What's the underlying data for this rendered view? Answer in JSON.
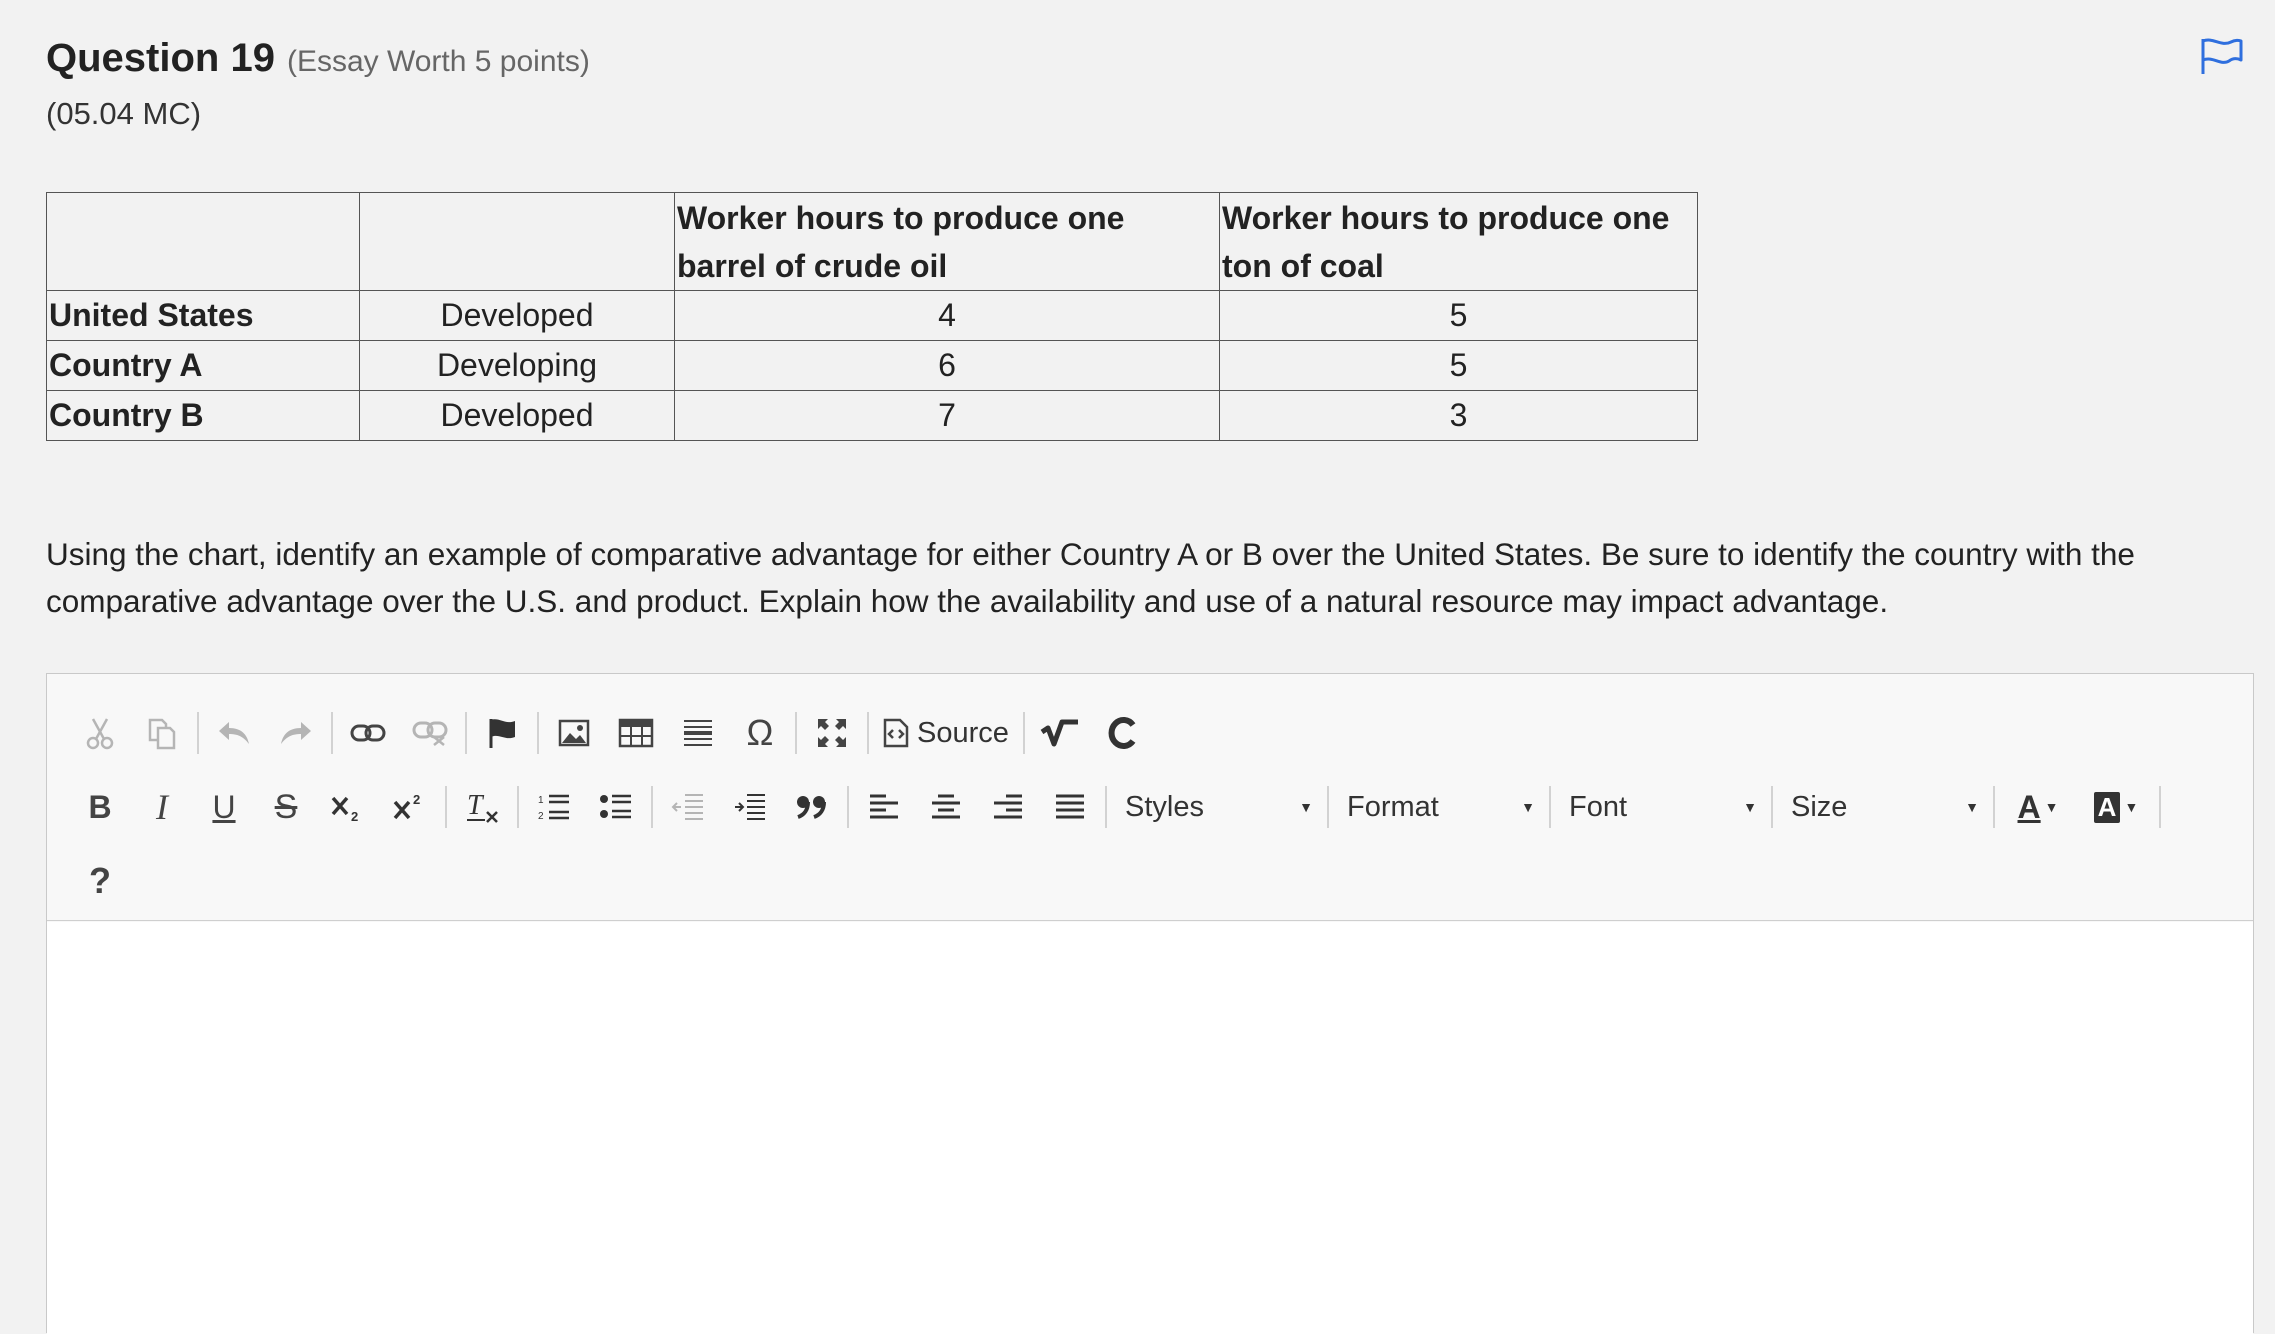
{
  "question": {
    "title": "Question 19",
    "points": "(Essay Worth 5 points)",
    "code": "(05.04 MC)"
  },
  "table": {
    "headers": [
      "",
      "",
      "Worker hours to produce one barrel of crude oil",
      "Worker hours to produce one ton of coal"
    ],
    "rows": [
      {
        "country": "United States",
        "status": "Developed",
        "oil": "4",
        "coal": "5"
      },
      {
        "country": "Country A",
        "status": "Developing",
        "oil": "6",
        "coal": "5"
      },
      {
        "country": "Country B",
        "status": "Developed",
        "oil": "7",
        "coal": "3"
      }
    ]
  },
  "prompt": "Using the chart, identify an example of comparative advantage for either Country A or B over the United States. Be sure to identify the country with the comparative advantage over the U.S. and product. Explain how the availability and use of a natural resource may impact advantage.",
  "editor": {
    "source_label": "Source",
    "styles_label": "Styles",
    "format_label": "Format",
    "font_label": "Font",
    "size_label": "Size",
    "bold_label": "B",
    "italic_label": "I",
    "underline_label": "U",
    "strike_label": "S",
    "help_label": "?",
    "text_color_label": "A",
    "bg_color_label": "A",
    "content": ""
  },
  "colors": {
    "flag": "#2f6fde",
    "background": "#f2f2f2"
  }
}
